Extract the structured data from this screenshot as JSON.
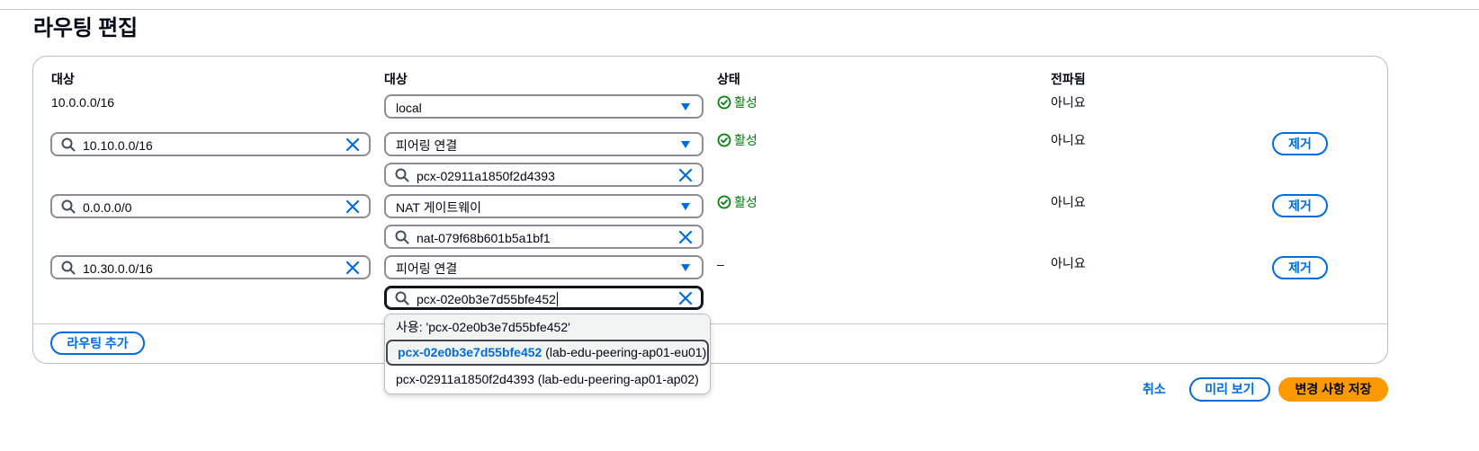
{
  "page": {
    "title": "라우팅 편집"
  },
  "columns": {
    "destination": "대상",
    "target": "대상",
    "status": "상태",
    "propagated": "전파됨"
  },
  "routes": [
    {
      "destination": "10.0.0.0/16",
      "target_type": "local",
      "target_id": "",
      "status": "활성",
      "propagated": "아니요",
      "remove": ""
    },
    {
      "destination": "10.10.0.0/16",
      "target_type": "피어링 연결",
      "target_id": "pcx-02911a1850f2d4393",
      "status": "활성",
      "propagated": "아니요",
      "remove": "제거"
    },
    {
      "destination": "0.0.0.0/0",
      "target_type": "NAT 게이트웨이",
      "target_id": "nat-079f68b601b5a1bf1",
      "status": "활성",
      "propagated": "아니요",
      "remove": "제거"
    },
    {
      "destination": "10.30.0.0/16",
      "target_type": "피어링 연결",
      "target_id": "pcx-02e0b3e7d55bfe452",
      "status": "–",
      "propagated": "아니요",
      "remove": "제거"
    }
  ],
  "dropdown": {
    "use_option": "사용: 'pcx-02e0b3e7d55bfe452'",
    "options": [
      {
        "id": "pcx-02e0b3e7d55bfe452",
        "name": "(lab-edu-peering-ap01-eu01)"
      },
      {
        "id": "pcx-02911a1850f2d4393",
        "name": "(lab-edu-peering-ap01-ap02)"
      }
    ]
  },
  "actions": {
    "add_route": "라우팅 추가",
    "cancel": "취소",
    "preview": "미리 보기",
    "save": "변경 사항 저장"
  },
  "colors": {
    "accent": "#006ce0",
    "success": "#037f0c",
    "primary_button": "#ff9900",
    "text": "#000716"
  },
  "icons": {
    "search": "search-icon",
    "clear": "close-icon",
    "dropdown": "caret-down-icon",
    "status_ok": "check-circle-icon"
  }
}
